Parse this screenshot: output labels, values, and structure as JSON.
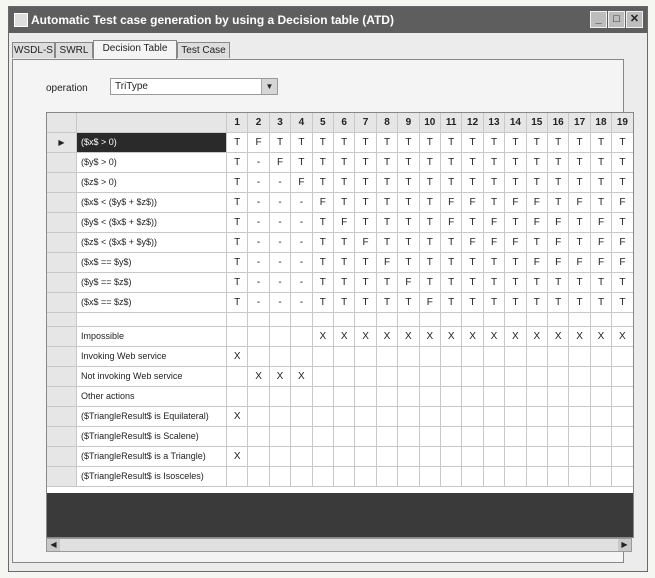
{
  "window": {
    "title": "Automatic Test case generation by using a Decision table (ATD)",
    "min": "_",
    "max": "□",
    "close": "✕"
  },
  "tabs": [
    {
      "label": "WSDL-S",
      "active": false
    },
    {
      "label": "SWRL",
      "active": false
    },
    {
      "label": "Decision Table",
      "active": true
    },
    {
      "label": "Test Case",
      "active": false
    }
  ],
  "operation": {
    "label": "operation",
    "value": "TriType"
  },
  "table": {
    "selected_row_marker": "▶",
    "columns": [
      "1",
      "2",
      "3",
      "4",
      "5",
      "6",
      "7",
      "8",
      "9",
      "10",
      "11",
      "12",
      "13",
      "14",
      "15",
      "16",
      "17",
      "18",
      "19"
    ],
    "conditions": [
      {
        "label": "($x$ > 0)",
        "values": [
          "T",
          "F",
          "T",
          "T",
          "T",
          "T",
          "T",
          "T",
          "T",
          "T",
          "T",
          "T",
          "T",
          "T",
          "T",
          "T",
          "T",
          "T",
          "T"
        ]
      },
      {
        "label": "($y$ > 0)",
        "values": [
          "T",
          "-",
          "F",
          "T",
          "T",
          "T",
          "T",
          "T",
          "T",
          "T",
          "T",
          "T",
          "T",
          "T",
          "T",
          "T",
          "T",
          "T",
          "T"
        ]
      },
      {
        "label": "($z$ > 0)",
        "values": [
          "T",
          "-",
          "-",
          "F",
          "T",
          "T",
          "T",
          "T",
          "T",
          "T",
          "T",
          "T",
          "T",
          "T",
          "T",
          "T",
          "T",
          "T",
          "T"
        ]
      },
      {
        "label": "($x$ < ($y$ + $z$))",
        "values": [
          "T",
          "-",
          "-",
          "-",
          "F",
          "T",
          "T",
          "T",
          "T",
          "T",
          "F",
          "F",
          "T",
          "F",
          "F",
          "T",
          "F",
          "T",
          "F"
        ]
      },
      {
        "label": "($y$ < ($x$ + $z$))",
        "values": [
          "T",
          "-",
          "-",
          "-",
          "T",
          "F",
          "T",
          "T",
          "T",
          "T",
          "F",
          "T",
          "F",
          "T",
          "F",
          "F",
          "T",
          "F",
          "T"
        ]
      },
      {
        "label": "($z$ < ($x$ + $y$))",
        "values": [
          "T",
          "-",
          "-",
          "-",
          "T",
          "T",
          "F",
          "T",
          "T",
          "T",
          "T",
          "F",
          "F",
          "F",
          "T",
          "F",
          "T",
          "F",
          "F"
        ]
      },
      {
        "label": "($x$ == $y$)",
        "values": [
          "T",
          "-",
          "-",
          "-",
          "T",
          "T",
          "T",
          "F",
          "T",
          "T",
          "T",
          "T",
          "T",
          "T",
          "F",
          "F",
          "F",
          "F",
          "F"
        ]
      },
      {
        "label": "($y$ == $z$)",
        "values": [
          "T",
          "-",
          "-",
          "-",
          "T",
          "T",
          "T",
          "T",
          "F",
          "T",
          "T",
          "T",
          "T",
          "T",
          "T",
          "T",
          "T",
          "T",
          "T"
        ]
      },
      {
        "label": "($x$ == $z$)",
        "values": [
          "T",
          "-",
          "-",
          "-",
          "T",
          "T",
          "T",
          "T",
          "T",
          "F",
          "T",
          "T",
          "T",
          "T",
          "T",
          "T",
          "T",
          "T",
          "T"
        ]
      }
    ],
    "actions": [
      {
        "label": "Impossible",
        "values": [
          "",
          "",
          "",
          "",
          "X",
          "X",
          "X",
          "X",
          "X",
          "X",
          "X",
          "X",
          "X",
          "X",
          "X",
          "X",
          "X",
          "X",
          "X"
        ]
      },
      {
        "label": "Invoking Web service",
        "values": [
          "X",
          "",
          "",
          "",
          "",
          "",
          "",
          "",
          "",
          "",
          "",
          "",
          "",
          "",
          "",
          "",
          "",
          "",
          ""
        ]
      },
      {
        "label": "Not invoking Web service",
        "values": [
          "",
          "X",
          "X",
          "X",
          "",
          "",
          "",
          "",
          "",
          "",
          "",
          "",
          "",
          "",
          "",
          "",
          "",
          "",
          ""
        ]
      },
      {
        "label": "Other actions",
        "values": [
          "",
          "",
          "",
          "",
          "",
          "",
          "",
          "",
          "",
          "",
          "",
          "",
          "",
          "",
          "",
          "",
          "",
          "",
          ""
        ]
      },
      {
        "label": "($TriangleResult$ is Equilateral)",
        "values": [
          "X",
          "",
          "",
          "",
          "",
          "",
          "",
          "",
          "",
          "",
          "",
          "",
          "",
          "",
          "",
          "",
          "",
          "",
          ""
        ]
      },
      {
        "label": "($TriangleResult$ is Scalene)",
        "values": [
          "",
          "",
          "",
          "",
          "",
          "",
          "",
          "",
          "",
          "",
          "",
          "",
          "",
          "",
          "",
          "",
          "",
          "",
          ""
        ]
      },
      {
        "label": "($TriangleResult$ is a Triangle)",
        "values": [
          "X",
          "",
          "",
          "",
          "",
          "",
          "",
          "",
          "",
          "",
          "",
          "",
          "",
          "",
          "",
          "",
          "",
          "",
          ""
        ]
      },
      {
        "label": "($TriangleResult$ is Isosceles)",
        "values": [
          "",
          "",
          "",
          "",
          "",
          "",
          "",
          "",
          "",
          "",
          "",
          "",
          "",
          "",
          "",
          "",
          "",
          "",
          ""
        ]
      }
    ]
  },
  "scrollbar": {
    "left": "◀",
    "right": "▶"
  }
}
